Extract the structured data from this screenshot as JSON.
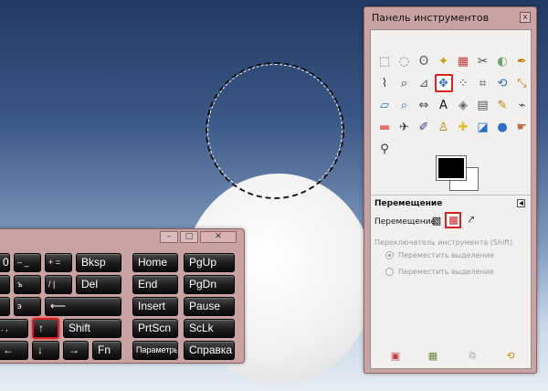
{
  "toolbox": {
    "title": "Панель инструментов",
    "close_glyph": "x",
    "tools": [
      {
        "name": "rect-select-icon",
        "glyph": "⬚",
        "color": "#666"
      },
      {
        "name": "ellipse-select-icon",
        "glyph": "◌",
        "color": "#666"
      },
      {
        "name": "lasso-icon",
        "glyph": "ʘ",
        "color": "#555"
      },
      {
        "name": "fuzzy-select-icon",
        "glyph": "✦",
        "color": "#c9a000"
      },
      {
        "name": "select-by-color-icon",
        "glyph": "▦",
        "color": "#c04040"
      },
      {
        "name": "scissors-icon",
        "glyph": "✂",
        "color": "#444"
      },
      {
        "name": "foreground-select-icon",
        "glyph": "◐",
        "color": "#6a6"
      },
      {
        "name": "paths-icon",
        "glyph": "✒",
        "color": "#c08000"
      },
      {
        "name": "color-picker-icon",
        "glyph": "⌇",
        "color": "#333"
      },
      {
        "name": "zoom-icon",
        "glyph": "⌕",
        "color": "#444"
      },
      {
        "name": "measure-icon",
        "glyph": "⊿",
        "color": "#555"
      },
      {
        "name": "move-icon",
        "glyph": "✥",
        "color": "#2a6fd0"
      },
      {
        "name": "align-icon",
        "glyph": "⁘",
        "color": "#444"
      },
      {
        "name": "crop-icon",
        "glyph": "⌗",
        "color": "#444"
      },
      {
        "name": "rotate-icon",
        "glyph": "⟲",
        "color": "#2a6fd0"
      },
      {
        "name": "scale-icon",
        "glyph": "⤡",
        "color": "#c08000"
      },
      {
        "name": "shear-icon",
        "glyph": "▱",
        "color": "#2a6fd0"
      },
      {
        "name": "perspective-icon",
        "glyph": "⌕",
        "color": "#2a6fd0"
      },
      {
        "name": "flip-icon",
        "glyph": "⇔",
        "color": "#444"
      },
      {
        "name": "text-icon",
        "glyph": "A",
        "color": "#111"
      },
      {
        "name": "bucket-fill-icon",
        "glyph": "◈",
        "color": "#666"
      },
      {
        "name": "blend-icon",
        "glyph": "▤",
        "color": "#555"
      },
      {
        "name": "pencil-icon",
        "glyph": "✎",
        "color": "#c08000"
      },
      {
        "name": "paintbrush-icon",
        "glyph": "⌁",
        "color": "#444"
      },
      {
        "name": "eraser-icon",
        "glyph": "▬",
        "color": "#e07070"
      },
      {
        "name": "airbrush-icon",
        "glyph": "✈",
        "color": "#444"
      },
      {
        "name": "ink-icon",
        "glyph": "✐",
        "color": "#2a3f8f"
      },
      {
        "name": "clone-icon",
        "glyph": "♙",
        "color": "#c08000"
      },
      {
        "name": "heal-icon",
        "glyph": "✚",
        "color": "#e0c020"
      },
      {
        "name": "perspective-clone-icon",
        "glyph": "◪",
        "color": "#2a6fd0"
      },
      {
        "name": "blur-icon",
        "glyph": "●",
        "color": "#2a6fd0"
      },
      {
        "name": "smudge-icon",
        "glyph": "☛",
        "color": "#c07040"
      },
      {
        "name": "dodge-burn-icon",
        "glyph": "⚲",
        "color": "#333"
      }
    ],
    "options_title": "Перемещение",
    "move_label": "Перемещение:",
    "switch_label": "Переключатель инструмента  (Shift)",
    "radio1": "Переместить выделение",
    "radio2": "Переместить выделение",
    "bottom_icons": [
      "save-options-icon",
      "restore-options-icon",
      "delete-options-icon",
      "reset-options-icon"
    ]
  },
  "keyboard": {
    "keys": [
      {
        "id": "key-0",
        "label": "0"
      },
      {
        "id": "key-minus",
        "label": "–  _"
      },
      {
        "id": "key-plus",
        "label": "+  ="
      },
      {
        "id": "key-bksp",
        "label": "Bksp"
      },
      {
        "id": "key-home",
        "label": "Home"
      },
      {
        "id": "key-pgup",
        "label": "PgUp"
      },
      {
        "id": "key-z",
        "label": ""
      },
      {
        "id": "key-hard-sign",
        "label": "ъ"
      },
      {
        "id": "key-slash",
        "label": "/  |"
      },
      {
        "id": "key-del",
        "label": "Del"
      },
      {
        "id": "key-end",
        "label": "End"
      },
      {
        "id": "key-pgdn",
        "label": "PgDn"
      },
      {
        "id": "key-zh",
        "label": ""
      },
      {
        "id": "key-e",
        "label": "э"
      },
      {
        "id": "key-enter",
        "label": "⟵"
      },
      {
        "id": "key-insert",
        "label": "Insert"
      },
      {
        "id": "key-pause",
        "label": "Pause"
      },
      {
        "id": "key-dot",
        "label": ". ,"
      },
      {
        "id": "key-up",
        "label": "↑"
      },
      {
        "id": "key-shift",
        "label": "Shift"
      },
      {
        "id": "key-prtscn",
        "label": "PrtScn"
      },
      {
        "id": "key-sclk",
        "label": "ScLk"
      },
      {
        "id": "key-left",
        "label": "←"
      },
      {
        "id": "key-down",
        "label": "↓"
      },
      {
        "id": "key-right",
        "label": "→"
      },
      {
        "id": "key-fn",
        "label": "Fn"
      },
      {
        "id": "key-params",
        "label": "Параметры"
      },
      {
        "id": "key-help",
        "label": "Справка"
      }
    ]
  }
}
